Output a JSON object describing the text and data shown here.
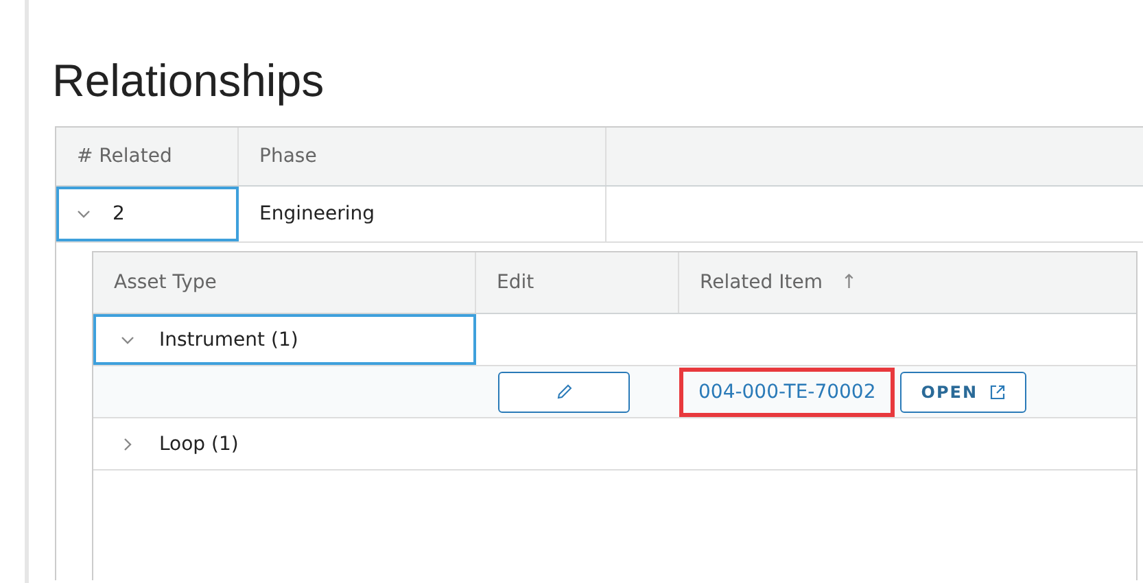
{
  "title": "Relationships",
  "table": {
    "columns": [
      "# Related",
      "Phase"
    ],
    "rows": [
      {
        "count": "2",
        "phase": "Engineering",
        "expanded": true,
        "selected": true,
        "detail": {
          "columns": [
            {
              "label": "Asset Type"
            },
            {
              "label": "Edit"
            },
            {
              "label": "Related Item",
              "sort": "↑"
            }
          ],
          "rows": [
            {
              "kind": "group",
              "label": "Instrument (1)",
              "expanded": true,
              "selected": true
            },
            {
              "kind": "item",
              "item": "004-000-TE-70002",
              "highlighted": true,
              "open_label": "OPEN"
            },
            {
              "kind": "group",
              "label": "Loop (1)",
              "expanded": false,
              "selected": false
            }
          ]
        }
      }
    ]
  }
}
